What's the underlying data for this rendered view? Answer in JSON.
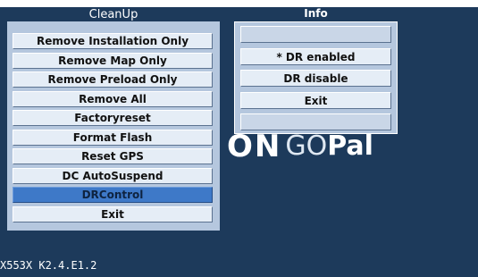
{
  "cleanup": {
    "title": "CleanUp",
    "items": [
      {
        "label": "Remove Installation Only"
      },
      {
        "label": "Remove Map Only"
      },
      {
        "label": "Remove Preload Only"
      },
      {
        "label": "Remove All"
      },
      {
        "label": "Factoryreset"
      },
      {
        "label": "Format Flash"
      },
      {
        "label": "Reset GPS"
      },
      {
        "label": "DC AutoSuspend"
      },
      {
        "label": "DRControl",
        "selected": true
      },
      {
        "label": "Exit"
      }
    ]
  },
  "info": {
    "title": "Info",
    "items": [
      {
        "label": ""
      },
      {
        "label": "* DR enabled"
      },
      {
        "label": "DR disable"
      },
      {
        "label": "Exit"
      },
      {
        "label": ""
      }
    ]
  },
  "logo": {
    "part1": "ON",
    "part2": "GO",
    "part3": "Pal"
  },
  "version": "X553X K2.4.E1.2",
  "colors": {
    "background": "#1d3a5b",
    "panel": "#b5c7de",
    "item": "#e5edf6",
    "selected": "#3e79c8"
  }
}
